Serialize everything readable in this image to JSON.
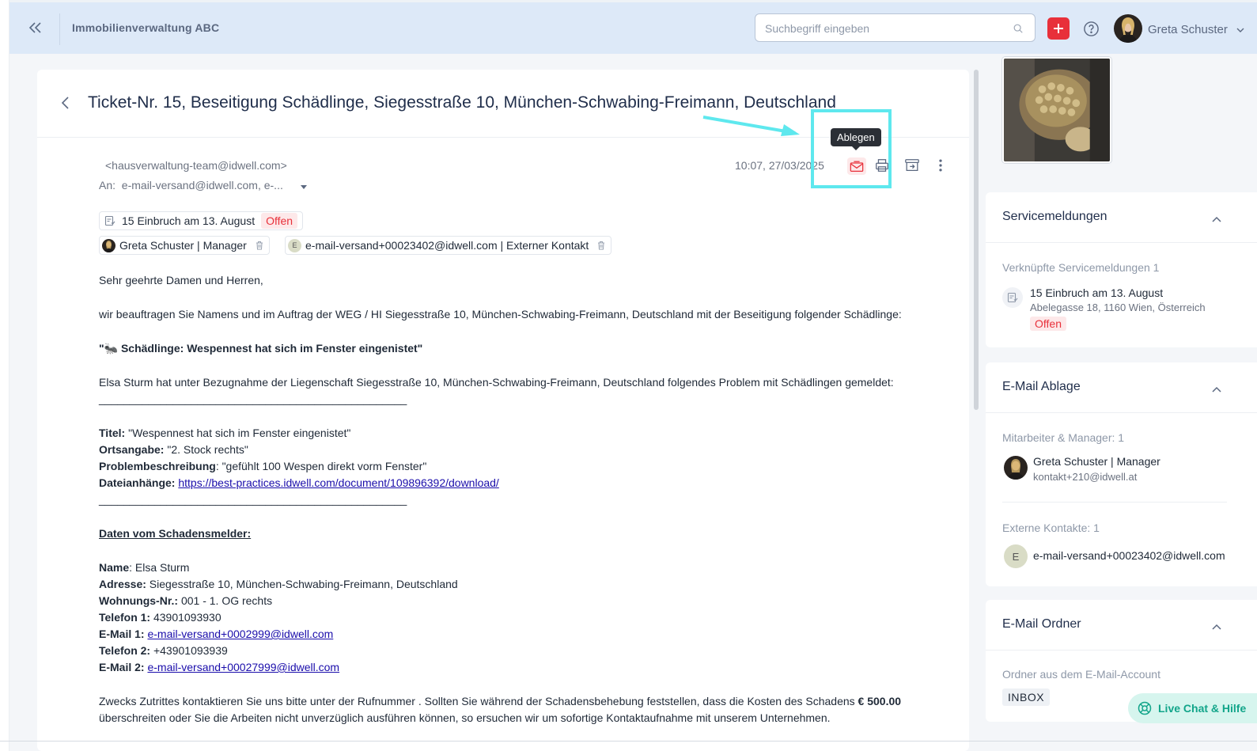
{
  "header": {
    "app_title": "Immobilienverwaltung ABC",
    "search_placeholder": "Suchbegriff eingeben",
    "user_name": "Greta Schuster"
  },
  "ticket": {
    "title": "Ticket-Nr. 15, Beseitigung Schädlinge, Siegesstraße 10, München-Schwabing-Freimann, Deutschland",
    "from": "<hausverwaltung-team@idwell.com>",
    "to_label": "An:",
    "to_value": "e-mail-versand@idwell.com, e-...",
    "date": "10:07, 27/03/2025",
    "tooltip": "Ablegen",
    "chip_ticket": "15 Einbruch am 13. August",
    "chip_status": "Offen",
    "chip_person1": "Greta Schuster | Manager",
    "chip_person2": "e-mail-versand+00023402@idwell.com | Externer Kontakt",
    "chip_person2_initial": "E"
  },
  "body": {
    "greeting": "Sehr geehrte Damen und Herren,",
    "intro": "wir beauftragen Sie Namens und im Auftrag der WEG / HI Siegesstraße 10, München-Schwabing-Freimann, Deutschland mit der Beseitigung folgender Schädlinge:",
    "pest_heading": "\"🐜 Schädlinge: Wespennest hat sich im Fenster eingenistet\"",
    "report": "Elsa Sturm hat unter Bezugnahme der Liegenschaft Siegesstraße 10, München-Schwabing-Freimann, Deutschland folgendes Problem mit Schädlingen gemeldet:",
    "separator": "__________________________________________________",
    "titel_label": "Titel:",
    "titel_value": " \"Wespennest hat sich im Fenster eingenistet\"",
    "ort_label": "Ortsangabe:",
    "ort_value": " \"2. Stock rechts\"",
    "problem_label": "Problembeschreibung",
    "problem_value": ": \"gefühlt 100 Wespen direkt vorm Fenster\"",
    "datei_label": "Dateianhänge:",
    "datei_link": "https://best-practices.idwell.com/document/109896392/download/",
    "daten_heading": "Daten vom Schadensmelder:",
    "name_label": "Name",
    "name_value": ": Elsa Sturm",
    "adresse_label": "Adresse:",
    "adresse_value": " Siegesstraße 10, München-Schwabing-Freimann, Deutschland",
    "wohnung_label": "Wohnungs-Nr.:",
    "wohnung_value": " 001 - 1. OG rechts",
    "tel1_label": "Telefon 1:",
    "tel1_value": " 43901093930",
    "mail1_label": "E-Mail 1:",
    "mail1_value": "e-mail-versand+0002999@idwell.com",
    "tel2_label": "Telefon 2:",
    "tel2_value": " +43901093939",
    "mail2_label": "E-Mail 2:",
    "mail2_value": "e-mail-versand+00027999@idwell.com",
    "closing_1": "Zwecks Zutrittes kontaktieren Sie uns bitte unter der Rufnummer . Sollten Sie während der Schadensbehebung feststellen, dass die Kosten des Schadens ",
    "closing_amount_1": "€",
    "closing_amount_2": "500.00",
    "closing_2": " überschreiten oder Sie die Arbeiten nicht unverzüglich ausführen können, so ersuchen wir um sofortige Kontaktaufnahme mit unserem Unternehmen."
  },
  "sidebar": {
    "service": {
      "heading": "Servicemeldungen",
      "sub": "Verknüpfte Servicemeldungen 1",
      "item_title": "15 Einbruch am 13. August",
      "item_address": "Abelegasse 18, 1160 Wien, Österreich",
      "item_status": "Offen"
    },
    "ablage": {
      "heading": "E-Mail Ablage",
      "sub_staff": "Mitarbeiter & Manager: 1",
      "staff_name": "Greta Schuster | Manager",
      "staff_mail": "kontakt+210@idwell.at",
      "sub_external": "Externe Kontakte: 1",
      "external_initial": "E",
      "external_mail": "e-mail-versand+00023402@idwell.com"
    },
    "ordner": {
      "heading": "E-Mail Ordner",
      "sub": "Ordner aus dem E-Mail-Account",
      "folder": "INBOX"
    }
  },
  "livechat": "Live Chat & Hilfe",
  "colors": {
    "accent_red": "#e8303a",
    "header_bg": "#dde9f8",
    "highlight": "#5ee8ee",
    "livechat": "#12a58a"
  }
}
